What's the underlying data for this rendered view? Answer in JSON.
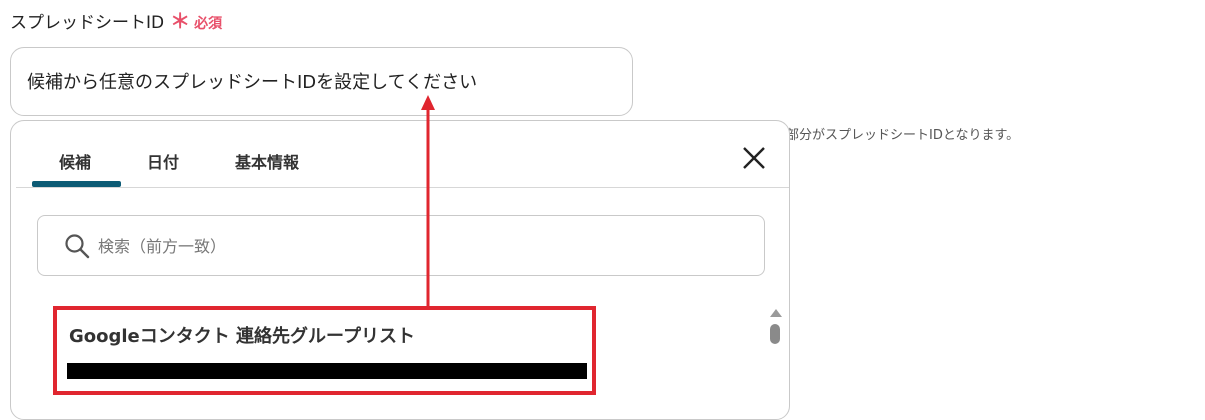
{
  "field": {
    "label": "スプレッドシートID",
    "required_mark": "＊",
    "required_text": "必須",
    "placeholder": "候補から任意のスプレッドシートIDを設定してください"
  },
  "hint": "部分がスプレッドシートIDとなります。",
  "popup": {
    "tabs": [
      {
        "label": "候補",
        "active": true
      },
      {
        "label": "日付",
        "active": false
      },
      {
        "label": "基本情報",
        "active": false
      }
    ],
    "close_icon": "close-icon",
    "search": {
      "icon": "search-icon",
      "placeholder": "検索（前方一致）"
    },
    "suggestions": [
      {
        "title": "Googleコンタクト 連絡先グループリスト",
        "id_redacted": true
      }
    ]
  },
  "colors": {
    "required": "#e8506a",
    "tab_underline": "#0c5b75",
    "highlight": "#e0262f"
  }
}
